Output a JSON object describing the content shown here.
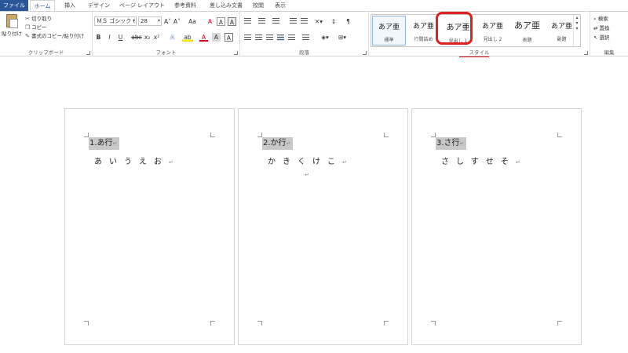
{
  "tabs": {
    "file": "ファイル",
    "home": "ホーム",
    "insert": "挿入",
    "design": "デザイン",
    "page_layout": "ページ レイアウト",
    "references": "参考資料",
    "mailings": "差し込み文書",
    "review": "校閲",
    "view": "表示"
  },
  "clipboard": {
    "paste": "貼り付け",
    "cut": "切り取り",
    "copy": "コピー",
    "format_painter": "書式のコピー/貼り付け",
    "label": "クリップボード"
  },
  "font": {
    "name": "ＭＳ ゴシック (",
    "size": "28",
    "label": "フォント",
    "grow": "A˄",
    "shrink": "A˅",
    "change_case": "Aa",
    "clear_format": "A",
    "bold": "B",
    "italic": "I",
    "underline": "U",
    "strikethrough": "abc",
    "subscript": "x₂",
    "superscript": "x²",
    "text_effects": "A",
    "highlight": "ab",
    "font_color": "A",
    "char_shading": "A",
    "char_border": "A"
  },
  "paragraph": {
    "label": "段落"
  },
  "styles": {
    "label": "スタイル",
    "items": [
      {
        "sample": "あア亜",
        "name": "標準"
      },
      {
        "sample": "あア亜",
        "name": "行間詰め"
      },
      {
        "sample": "あア亜",
        "name": "見出し 1"
      },
      {
        "sample": "あア亜",
        "name": "見出し 2"
      },
      {
        "sample": "あア亜",
        "name": "表題"
      },
      {
        "sample": "あア亜",
        "name": "副題"
      }
    ]
  },
  "editing": {
    "label": "編集",
    "find": "検索",
    "replace": "置換",
    "select": "選択"
  },
  "pages": [
    {
      "heading": "1.あ行",
      "kana": "あいうえお"
    },
    {
      "heading": "2.か行",
      "kana": "かきくけこ"
    },
    {
      "heading": "3.さ行",
      "kana": "さしすせそ"
    }
  ],
  "marks": {
    "paragraph": "↵"
  },
  "colors": {
    "file_tab": "#2b579a",
    "annotation": "#e02020",
    "heading_bg": "#c8c8c8"
  }
}
